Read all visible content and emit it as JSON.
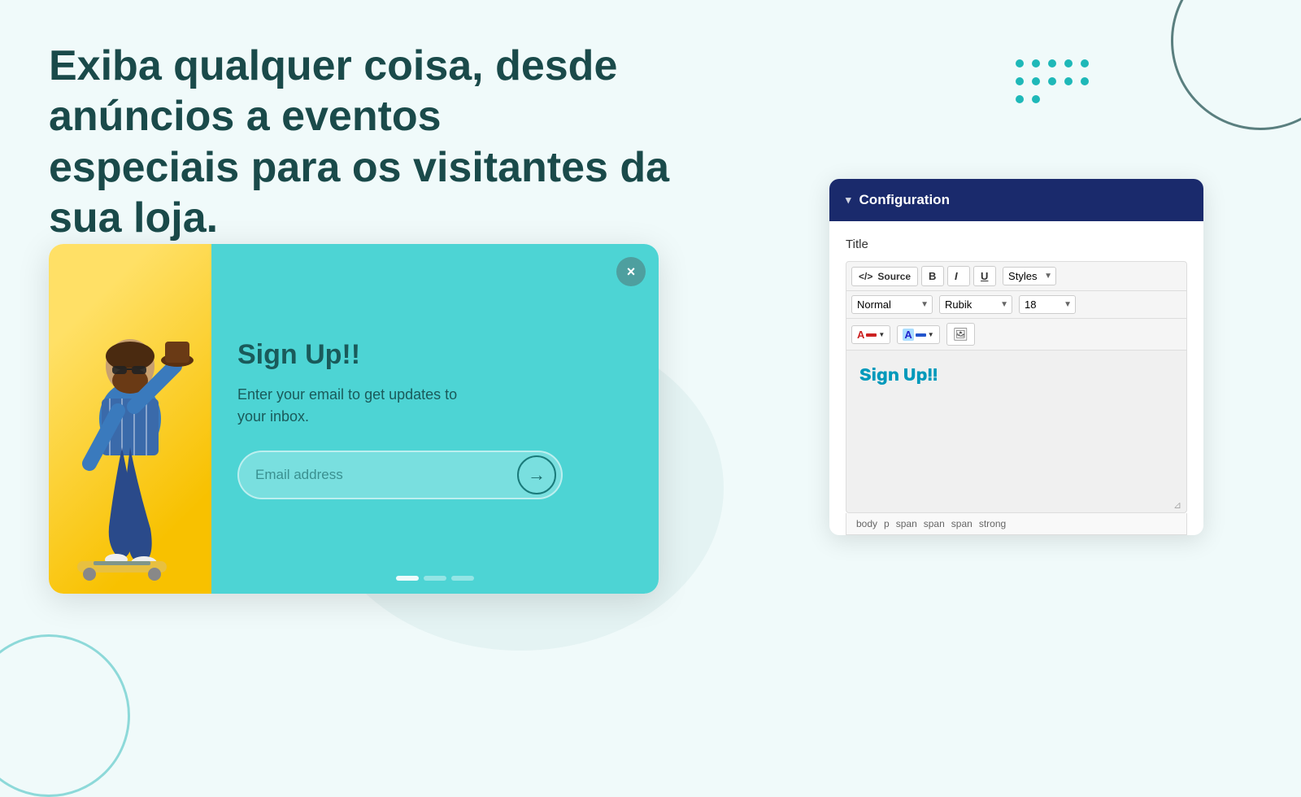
{
  "headline": {
    "line1": "Exiba qualquer coisa, desde anúncios a eventos",
    "line2": "especiais para os visitantes da sua loja."
  },
  "popup": {
    "title": "Sign Up!!",
    "description_line1": "Enter your email to get updates to",
    "description_line2": "your inbox.",
    "email_placeholder": "Email address",
    "close_label": "×"
  },
  "config": {
    "header_label": "Configuration",
    "header_arrow": "▾",
    "title_label": "Title",
    "toolbar": {
      "source_label": "Source",
      "bold_label": "B",
      "italic_label": "I",
      "underline_label": "U",
      "styles_label": "Styles",
      "normal_label": "Normal",
      "font_label": "Rubik",
      "size_label": "18",
      "color_a_label": "A",
      "highlight_a_label": "A",
      "image_label": "🖼"
    },
    "editor_content": "Sign Up!!",
    "statusbar": {
      "items": [
        "body",
        "p",
        "span",
        "span",
        "span",
        "strong"
      ]
    }
  },
  "dots_grid": "⠿",
  "colors": {
    "teal_dark": "#1a4a4a",
    "teal_medium": "#4dd4d4",
    "config_header_bg": "#1a2a6c",
    "sign_up_color": "#0099bb"
  }
}
